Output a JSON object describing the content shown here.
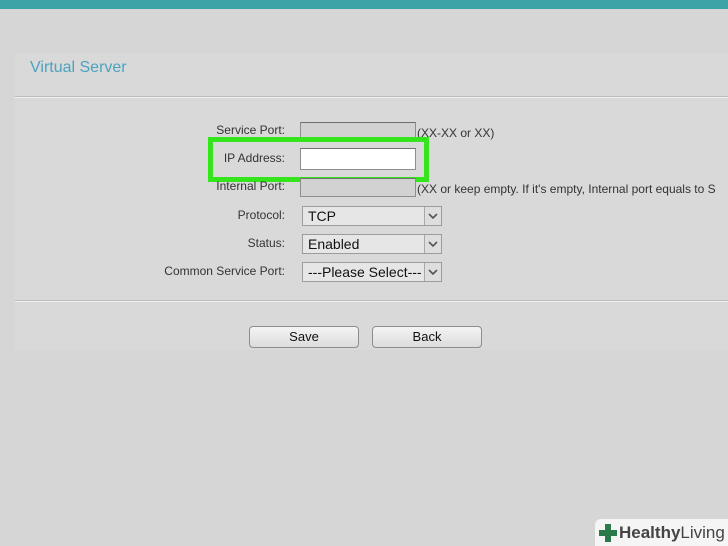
{
  "page": {
    "title": "Virtual Server"
  },
  "form": {
    "service_port": {
      "label": "Service Port:",
      "value": "",
      "hint": "(XX-XX or XX)"
    },
    "ip_address": {
      "label": "IP Address:",
      "value": ""
    },
    "internal_port": {
      "label": "Internal Port:",
      "value": "",
      "hint": "(XX or keep empty. If it's empty, Internal port equals to S"
    },
    "protocol": {
      "label": "Protocol:",
      "selected": "TCP"
    },
    "status": {
      "label": "Status:",
      "selected": "Enabled"
    },
    "common_service_port": {
      "label": "Common Service Port:",
      "selected": "---Please Select---"
    }
  },
  "buttons": {
    "save": "Save",
    "back": "Back"
  },
  "highlight": {
    "color": "#34e51c",
    "target": "ip_address"
  },
  "watermark": {
    "brand_bold": "Healthy",
    "brand_light": "Living",
    "icon": "cross-icon"
  },
  "colors": {
    "topbar": "#3da3a6",
    "title": "#4aa3bf",
    "background": "#d6d6d6"
  }
}
